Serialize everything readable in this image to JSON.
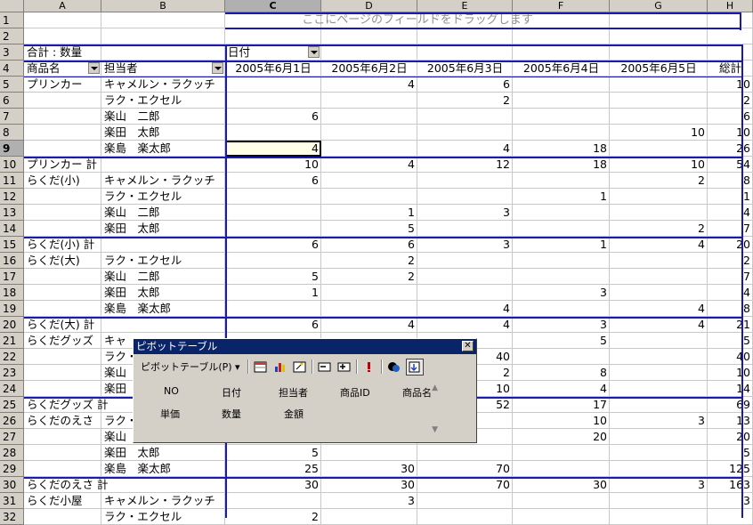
{
  "column_headers": [
    "A",
    "B",
    "C",
    "D",
    "E",
    "F",
    "G",
    "H"
  ],
  "selected_column": "C",
  "selected_row": "9",
  "rows": [
    {
      "n": "1",
      "cells": [
        {
          "c": "center",
          "v": "ここにページのフィールドをドラッグします"
        }
      ]
    },
    {
      "n": "2",
      "cells": []
    },
    {
      "n": "3",
      "cells": [
        {
          "c": "A",
          "v": "合計 : 数量"
        },
        {
          "c": "C",
          "v": "日付",
          "dd": true
        }
      ]
    },
    {
      "n": "4",
      "cells": [
        {
          "c": "A",
          "v": "商品名",
          "dd": true
        },
        {
          "c": "B",
          "v": "担当者",
          "dd": true
        },
        {
          "c": "C",
          "v": "2005年6月1日"
        },
        {
          "c": "D",
          "v": "2005年6月2日"
        },
        {
          "c": "E",
          "v": "2005年6月3日"
        },
        {
          "c": "F",
          "v": "2005年6月4日"
        },
        {
          "c": "G",
          "v": "2005年6月5日"
        },
        {
          "c": "H",
          "v": "総計"
        }
      ]
    },
    {
      "n": "5",
      "cells": [
        {
          "c": "A",
          "v": "プリンカー"
        },
        {
          "c": "B",
          "v": "キャメルン・ラクッチ"
        },
        {
          "c": "D",
          "v": "4"
        },
        {
          "c": "E",
          "v": "6"
        },
        {
          "c": "H",
          "v": "10"
        }
      ]
    },
    {
      "n": "6",
      "cells": [
        {
          "c": "B",
          "v": "ラク・エクセル"
        },
        {
          "c": "E",
          "v": "2"
        },
        {
          "c": "H",
          "v": "2"
        }
      ]
    },
    {
      "n": "7",
      "cells": [
        {
          "c": "B",
          "v": "楽山　二郎"
        },
        {
          "c": "C",
          "v": "6"
        },
        {
          "c": "H",
          "v": "6"
        }
      ]
    },
    {
      "n": "8",
      "cells": [
        {
          "c": "B",
          "v": "楽田　太郎"
        },
        {
          "c": "G",
          "v": "10"
        },
        {
          "c": "H",
          "v": "10"
        }
      ]
    },
    {
      "n": "9",
      "cells": [
        {
          "c": "B",
          "v": "楽島　楽太郎"
        },
        {
          "c": "C",
          "v": "4",
          "sel": true
        },
        {
          "c": "E",
          "v": "4"
        },
        {
          "c": "F",
          "v": "18"
        },
        {
          "c": "H",
          "v": "26"
        }
      ]
    },
    {
      "n": "10",
      "cells": [
        {
          "c": "A",
          "v": "プリンカー 計"
        },
        {
          "c": "C",
          "v": "10"
        },
        {
          "c": "D",
          "v": "4"
        },
        {
          "c": "E",
          "v": "12"
        },
        {
          "c": "F",
          "v": "18"
        },
        {
          "c": "G",
          "v": "10"
        },
        {
          "c": "H",
          "v": "54"
        }
      ]
    },
    {
      "n": "11",
      "cells": [
        {
          "c": "A",
          "v": "らくだ(小)"
        },
        {
          "c": "B",
          "v": "キャメルン・ラクッチ"
        },
        {
          "c": "C",
          "v": "6"
        },
        {
          "c": "G",
          "v": "2"
        },
        {
          "c": "H",
          "v": "8"
        }
      ]
    },
    {
      "n": "12",
      "cells": [
        {
          "c": "B",
          "v": "ラク・エクセル"
        },
        {
          "c": "F",
          "v": "1"
        },
        {
          "c": "H",
          "v": "1"
        }
      ]
    },
    {
      "n": "13",
      "cells": [
        {
          "c": "B",
          "v": "楽山　二郎"
        },
        {
          "c": "D",
          "v": "1"
        },
        {
          "c": "E",
          "v": "3"
        },
        {
          "c": "H",
          "v": "4"
        }
      ]
    },
    {
      "n": "14",
      "cells": [
        {
          "c": "B",
          "v": "楽田　太郎"
        },
        {
          "c": "D",
          "v": "5"
        },
        {
          "c": "G",
          "v": "2"
        },
        {
          "c": "H",
          "v": "7"
        }
      ]
    },
    {
      "n": "15",
      "cells": [
        {
          "c": "A",
          "v": "らくだ(小) 計"
        },
        {
          "c": "C",
          "v": "6"
        },
        {
          "c": "D",
          "v": "6"
        },
        {
          "c": "E",
          "v": "3"
        },
        {
          "c": "F",
          "v": "1"
        },
        {
          "c": "G",
          "v": "4"
        },
        {
          "c": "H",
          "v": "20"
        }
      ]
    },
    {
      "n": "16",
      "cells": [
        {
          "c": "A",
          "v": "らくだ(大)"
        },
        {
          "c": "B",
          "v": "ラク・エクセル"
        },
        {
          "c": "D",
          "v": "2"
        },
        {
          "c": "H",
          "v": "2"
        }
      ]
    },
    {
      "n": "17",
      "cells": [
        {
          "c": "B",
          "v": "楽山　二郎"
        },
        {
          "c": "C",
          "v": "5"
        },
        {
          "c": "D",
          "v": "2"
        },
        {
          "c": "H",
          "v": "7"
        }
      ]
    },
    {
      "n": "18",
      "cells": [
        {
          "c": "B",
          "v": "楽田　太郎"
        },
        {
          "c": "C",
          "v": "1"
        },
        {
          "c": "F",
          "v": "3"
        },
        {
          "c": "H",
          "v": "4"
        }
      ]
    },
    {
      "n": "19",
      "cells": [
        {
          "c": "B",
          "v": "楽島　楽太郎"
        },
        {
          "c": "E",
          "v": "4"
        },
        {
          "c": "G",
          "v": "4"
        },
        {
          "c": "H",
          "v": "8"
        }
      ]
    },
    {
      "n": "20",
      "cells": [
        {
          "c": "A",
          "v": "らくだ(大) 計"
        },
        {
          "c": "C",
          "v": "6"
        },
        {
          "c": "D",
          "v": "4"
        },
        {
          "c": "E",
          "v": "4"
        },
        {
          "c": "F",
          "v": "3"
        },
        {
          "c": "G",
          "v": "4"
        },
        {
          "c": "H",
          "v": "21"
        }
      ]
    },
    {
      "n": "21",
      "cells": [
        {
          "c": "A",
          "v": "らくだグッズ"
        },
        {
          "c": "B",
          "v": "キャ"
        },
        {
          "c": "F",
          "v": "5"
        },
        {
          "c": "H",
          "v": "5"
        }
      ]
    },
    {
      "n": "22",
      "cells": [
        {
          "c": "B",
          "v": "ラク・"
        },
        {
          "c": "E",
          "v": "40"
        },
        {
          "c": "H",
          "v": "40"
        }
      ]
    },
    {
      "n": "23",
      "cells": [
        {
          "c": "B",
          "v": "楽山"
        },
        {
          "c": "E",
          "v": "2"
        },
        {
          "c": "F",
          "v": "8"
        },
        {
          "c": "H",
          "v": "10"
        }
      ]
    },
    {
      "n": "24",
      "cells": [
        {
          "c": "B",
          "v": "楽田"
        },
        {
          "c": "E",
          "v": "10"
        },
        {
          "c": "F",
          "v": "4"
        },
        {
          "c": "H",
          "v": "14"
        }
      ]
    },
    {
      "n": "25",
      "cells": [
        {
          "c": "A",
          "v": "らくだグッズ 計"
        },
        {
          "c": "E",
          "v": "52"
        },
        {
          "c": "F",
          "v": "17"
        },
        {
          "c": "H",
          "v": "69"
        }
      ]
    },
    {
      "n": "26",
      "cells": [
        {
          "c": "A",
          "v": "らくだのえさ"
        },
        {
          "c": "B",
          "v": "ラク・"
        },
        {
          "c": "F",
          "v": "10"
        },
        {
          "c": "G",
          "v": "3"
        },
        {
          "c": "H",
          "v": "13"
        }
      ]
    },
    {
      "n": "27",
      "cells": [
        {
          "c": "B",
          "v": "楽山"
        },
        {
          "c": "F",
          "v": "20"
        },
        {
          "c": "H",
          "v": "20"
        }
      ]
    },
    {
      "n": "28",
      "cells": [
        {
          "c": "B",
          "v": "楽田　太郎"
        },
        {
          "c": "C",
          "v": "5"
        },
        {
          "c": "H",
          "v": "5"
        }
      ]
    },
    {
      "n": "29",
      "cells": [
        {
          "c": "B",
          "v": "楽島　楽太郎"
        },
        {
          "c": "C",
          "v": "25"
        },
        {
          "c": "D",
          "v": "30"
        },
        {
          "c": "E",
          "v": "70"
        },
        {
          "c": "H",
          "v": "125"
        }
      ]
    },
    {
      "n": "30",
      "cells": [
        {
          "c": "A",
          "v": "らくだのえさ 計"
        },
        {
          "c": "C",
          "v": "30"
        },
        {
          "c": "D",
          "v": "30"
        },
        {
          "c": "E",
          "v": "70"
        },
        {
          "c": "F",
          "v": "30"
        },
        {
          "c": "G",
          "v": "3"
        },
        {
          "c": "H",
          "v": "163"
        }
      ]
    },
    {
      "n": "31",
      "cells": [
        {
          "c": "A",
          "v": "らくだ小屋"
        },
        {
          "c": "B",
          "v": "キャメルン・ラクッチ"
        },
        {
          "c": "D",
          "v": "3"
        },
        {
          "c": "H",
          "v": "3"
        }
      ]
    },
    {
      "n": "32",
      "cells": [
        {
          "c": "B",
          "v": "ラク・エクセル"
        },
        {
          "c": "C",
          "v": "2"
        }
      ]
    }
  ],
  "pivot_toolbar": {
    "title": "ピボットテーブル",
    "close": "✕",
    "menu_label": "ピボットテーブル(P) ▾",
    "icons": [
      "format-report-icon",
      "chart-wizard-icon",
      "pivot-wizard-icon",
      "hide-detail-icon",
      "show-detail-icon",
      "refresh-data-icon",
      "field-settings-icon",
      "show-field-list-icon"
    ],
    "fields_row1": [
      "NO",
      "日付",
      "担当者",
      "商品ID",
      "商品名"
    ],
    "fields_row2": [
      "単価",
      "数量",
      "金額"
    ],
    "scroll_up": "▲",
    "scroll_down": "▼"
  }
}
